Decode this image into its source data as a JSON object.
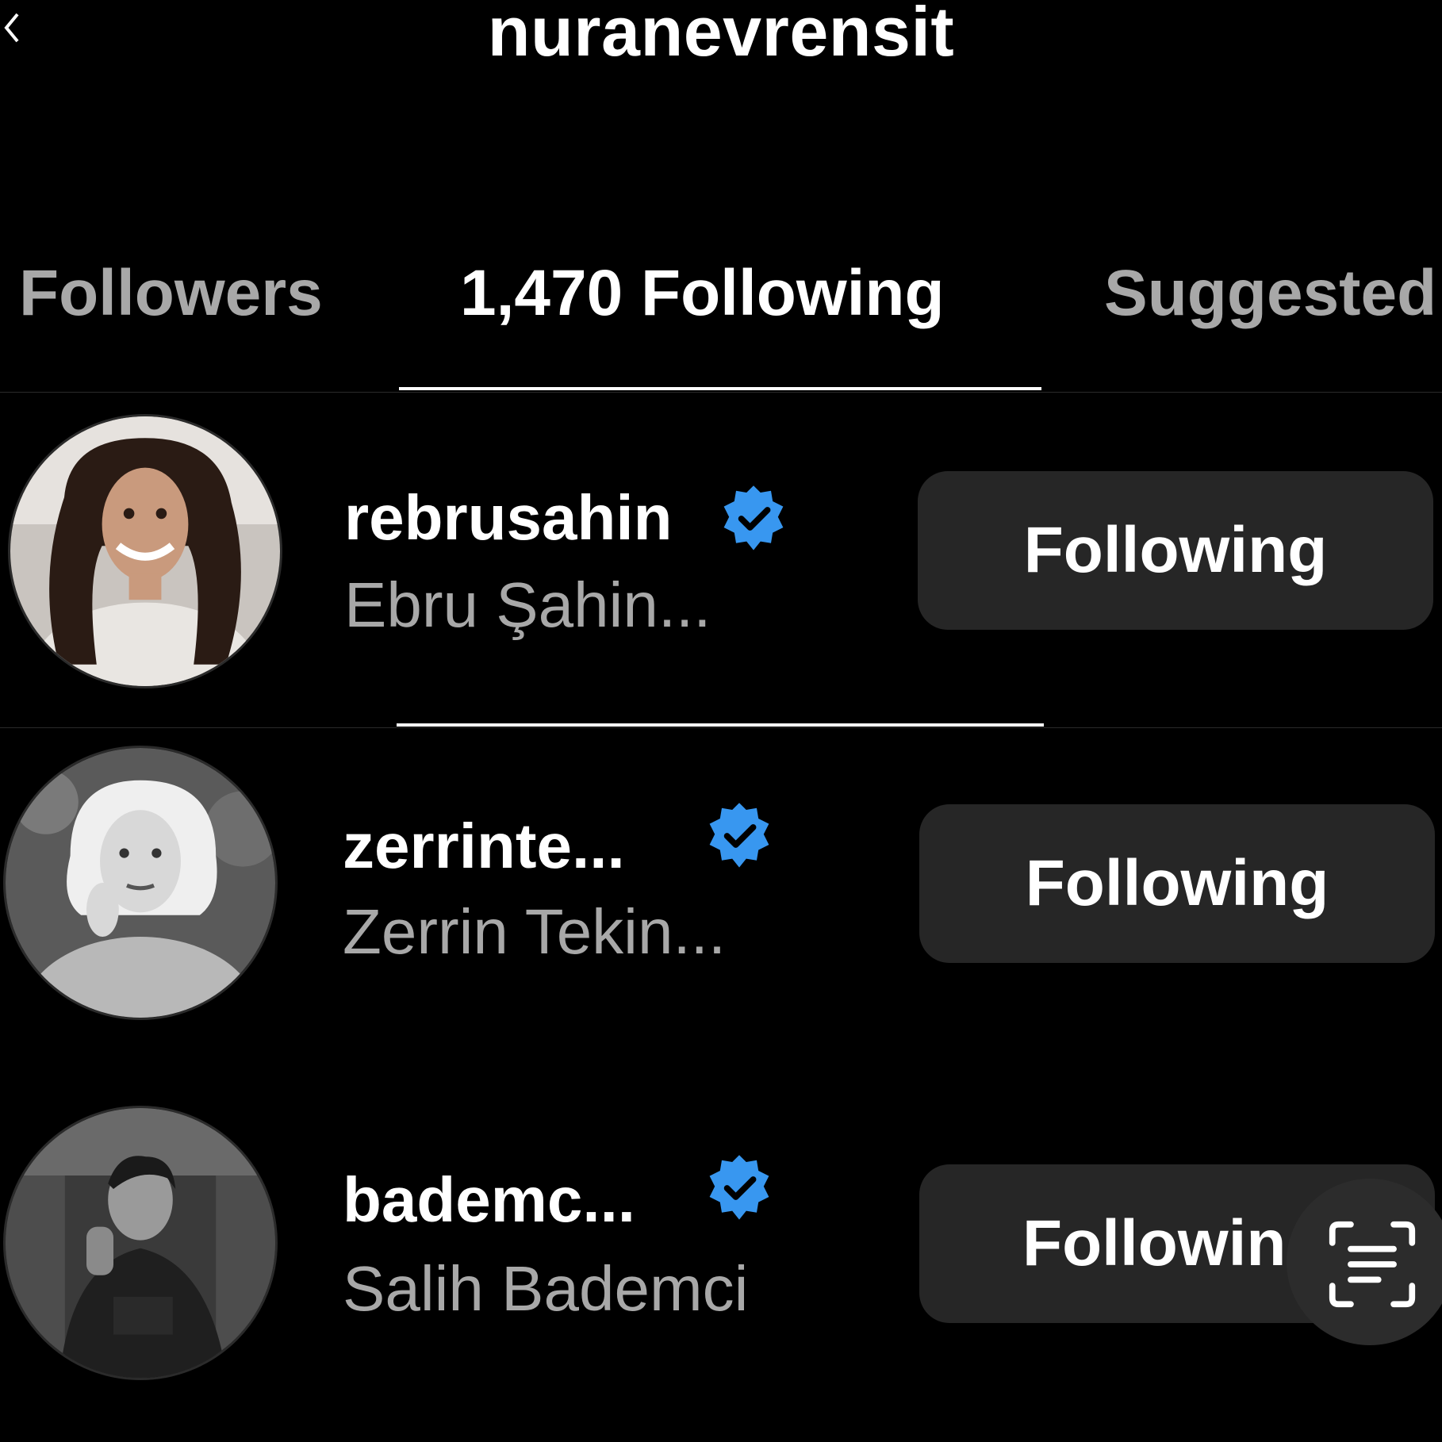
{
  "header": {
    "username": "nuranevrensit"
  },
  "tabs": [
    {
      "label": "Followers",
      "active": false
    },
    {
      "label": "1,470 Following",
      "active": true
    },
    {
      "label": "Suggested",
      "active": false
    }
  ],
  "users": [
    {
      "username": "rebrusahin",
      "full_name": "Ebru Şahin...",
      "verified": true,
      "button_label": "Following"
    },
    {
      "username": "zerrinte...",
      "full_name": "Zerrin Tekin...",
      "verified": true,
      "button_label": "Following"
    },
    {
      "username": "bademc...",
      "full_name": "Salih Bademci",
      "verified": true,
      "button_label": "Following"
    }
  ],
  "icons": {
    "verified": "verified-badge-icon",
    "scan": "text-scan-icon",
    "back": "back-arrow-icon"
  },
  "colors": {
    "background": "#000000",
    "secondary_text": "#a8a8a8",
    "button_bg": "#262626",
    "verified_blue": "#3897f0"
  }
}
